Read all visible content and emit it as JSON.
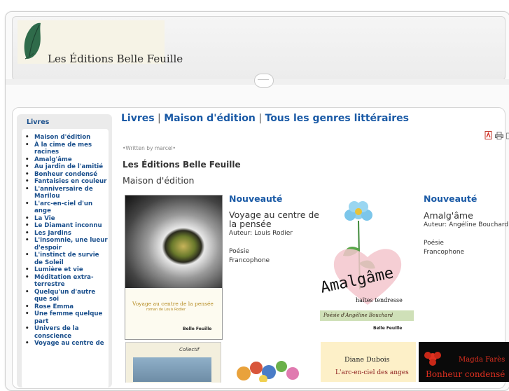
{
  "header": {
    "logo_text": "Les Éditions Belle Feuille"
  },
  "sidebar": {
    "title": "Livres",
    "items": [
      {
        "label": "Maison d'édition"
      },
      {
        "label": "À la cime de mes racines"
      },
      {
        "label": "Amalg'âme"
      },
      {
        "label": "Au jardin de l'amitié"
      },
      {
        "label": "Bonheur condensé"
      },
      {
        "label": "Fantaisies en couleur"
      },
      {
        "label": "L'anniversaire de Marilou"
      },
      {
        "label": "L'arc-en-ciel d'un ange"
      },
      {
        "label": "La Vie"
      },
      {
        "label": "Le Diamant inconnu"
      },
      {
        "label": "Les Jardins"
      },
      {
        "label": "L'insomnie, une lueur d'espoir"
      },
      {
        "label": "L'instinct de survie de Soleil"
      },
      {
        "label": "Lumière et vie"
      },
      {
        "label": "Méditation extra-terrestre"
      },
      {
        "label": "Quelqu'un d'autre que soi"
      },
      {
        "label": "Rose Emma"
      },
      {
        "label": "Une femme quelque part"
      },
      {
        "label": "Univers de la conscience"
      },
      {
        "label": "Voyage au centre de"
      }
    ]
  },
  "main": {
    "breadcrumb": {
      "part1": "Livres",
      "sep1": " | ",
      "part2": "Maison d'édition",
      "sep2": " | ",
      "part3": "Tous les genres littéraires"
    },
    "written_by": "•Written by marcel•",
    "article_title": "Les Éditions Belle Feuille",
    "article_subtitle": "Maison d'édition",
    "icons": [
      "pdf-icon",
      "print-icon",
      "email-icon"
    ]
  },
  "books": {
    "first": {
      "heading": "Nouveauté",
      "title": "Voyage au centre de la pensée",
      "author": "Auteur: Louis Rodier",
      "genre": "Poésie",
      "language": "Francophone",
      "cover_title": "Voyage au centre de la pensée",
      "cover_author": "roman de Louis Rodier",
      "cover_publisher": "Belle Feuille"
    },
    "second": {
      "heading": "Nouveauté",
      "title": "Amalg'âme",
      "author": "Auteur: Angéline Bouchard",
      "genre": "Poésie",
      "language": "Francophone",
      "cover_word": "Amalgâme",
      "cover_subtitle": "haïtes tendresse",
      "cover_band": "Poésie d'Angéline Bouchard",
      "cover_publisher": "Belle Feuille"
    }
  },
  "thumbnails": {
    "t1_text": "Collectif",
    "t3_author": "Diane Dubois",
    "t3_title": "L'arc-en-ciel des anges",
    "t4_author": "Magda Farès",
    "t4_title": "Bonheur condensé"
  },
  "colors": {
    "link_blue": "#1a5aa6",
    "sidebar_link": "#1a4f8c",
    "frame_border": "#d6d6d6"
  }
}
